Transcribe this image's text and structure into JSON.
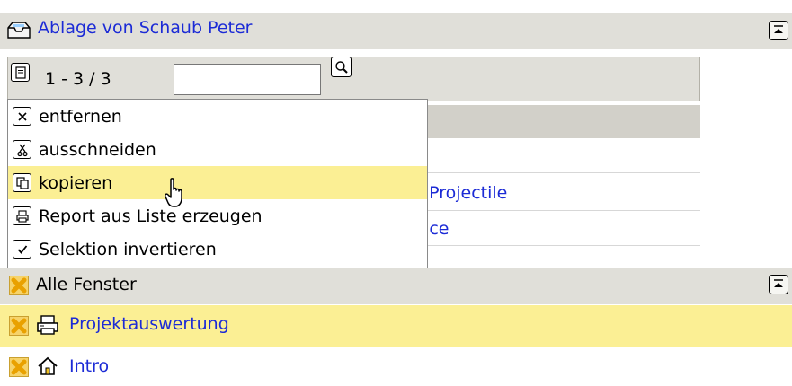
{
  "panel1": {
    "title": "Ablage von Schaub Peter",
    "pager": "1 - 3 / 3",
    "search_value": "",
    "rows": [
      {
        "text": ""
      },
      {
        "text": ""
      },
      {
        "text": "n Projectile"
      },
      {
        "text": "face"
      }
    ]
  },
  "context_menu": {
    "items": [
      {
        "label": "entfernen",
        "icon": "close-box-icon"
      },
      {
        "label": "ausschneiden",
        "icon": "scissors-icon"
      },
      {
        "label": "kopieren",
        "icon": "copy-icon"
      },
      {
        "label": "Report aus Liste erzeugen",
        "icon": "printer-icon"
      },
      {
        "label": "Selektion invertieren",
        "icon": "checkbox-icon"
      }
    ],
    "highlighted_index": 2
  },
  "panel2": {
    "title": "Alle Fenster",
    "rows": [
      {
        "label": "Projektauswertung",
        "icon": "printer-icon"
      },
      {
        "label": "Intro",
        "icon": "home-icon"
      }
    ]
  },
  "colors": {
    "header_bg": "#e0dfd9",
    "highlight": "#fbef94",
    "link": "#1c2bd6",
    "close_x": "#f5b92a"
  }
}
